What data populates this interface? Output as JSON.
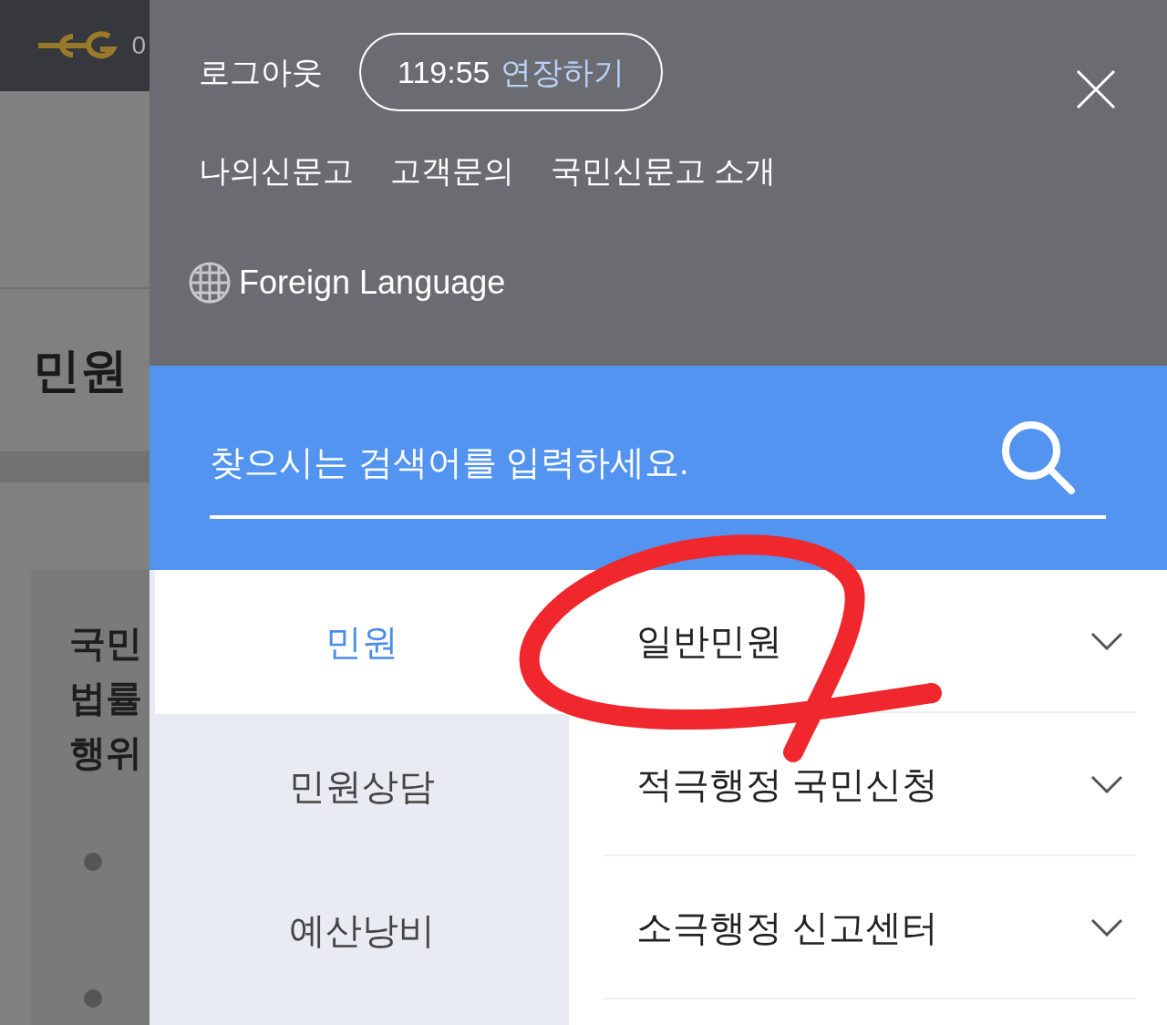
{
  "background": {
    "logo_text": "0",
    "title": "민원",
    "card_lines": [
      "국민",
      "법률",
      "행위"
    ]
  },
  "session": {
    "logout": "로그아웃",
    "timer": "119:55",
    "extend": "연장하기"
  },
  "links": [
    "나의신문고",
    "고객문의",
    "국민신문고 소개"
  ],
  "language": "Foreign Language",
  "search": {
    "placeholder": "찾으시는 검색어를 입력하세요."
  },
  "menu": {
    "categories": [
      {
        "label": "민원",
        "selected": true
      },
      {
        "label": "민원상담",
        "selected": false
      },
      {
        "label": "예산낭비",
        "selected": false
      }
    ],
    "items": [
      {
        "label": "일반민원",
        "expanded": false
      },
      {
        "label": "적극행정 국민신청",
        "expanded": false
      },
      {
        "label": "소극행정 신고센터",
        "expanded": false
      }
    ]
  }
}
